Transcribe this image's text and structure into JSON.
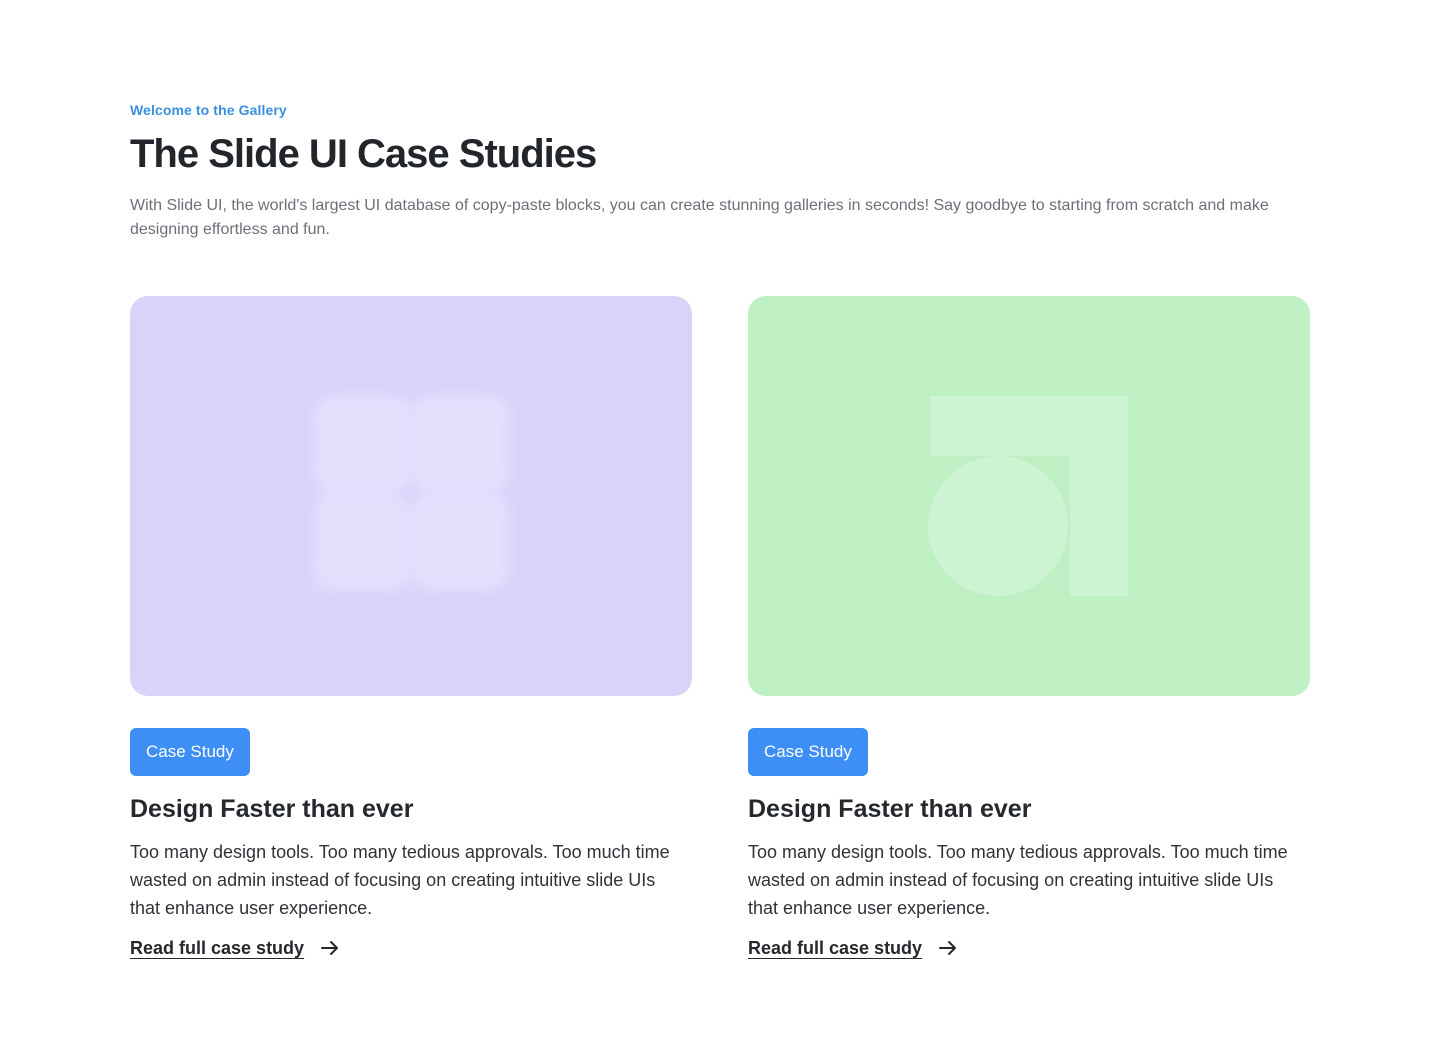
{
  "header": {
    "eyebrow": "Welcome to the Gallery",
    "title": "The Slide UI Case Studies",
    "intro": "With Slide UI, the world's largest UI database of copy-paste blocks, you can create stunning galleries in seconds! Say goodbye to starting from scratch and make designing effortless and fun."
  },
  "colors": {
    "accent": "#3b8fe0",
    "badge": "#3d8ef5",
    "card1_bg": "#dbd2fa",
    "card1_shape": "#e5dffc",
    "card2_bg": "#bff0c4",
    "card2_shape": "#cdf4d2"
  },
  "cards": [
    {
      "badge": "Case Study",
      "title": "Design Faster than ever",
      "text": "Too many design tools. Too many tedious approvals. Too much time wasted on admin instead of focusing on creating intuitive slide UIs that enhance user experience.",
      "link": "Read full case study",
      "icon": "blurred-grid-logo-icon"
    },
    {
      "badge": "Case Study",
      "title": "Design Faster than ever",
      "text": "Too many design tools. Too many tedious approvals. Too much time wasted on admin instead of focusing on creating intuitive slide UIs that enhance user experience.",
      "link": "Read full case study",
      "icon": "square-circle-logo-icon"
    }
  ]
}
